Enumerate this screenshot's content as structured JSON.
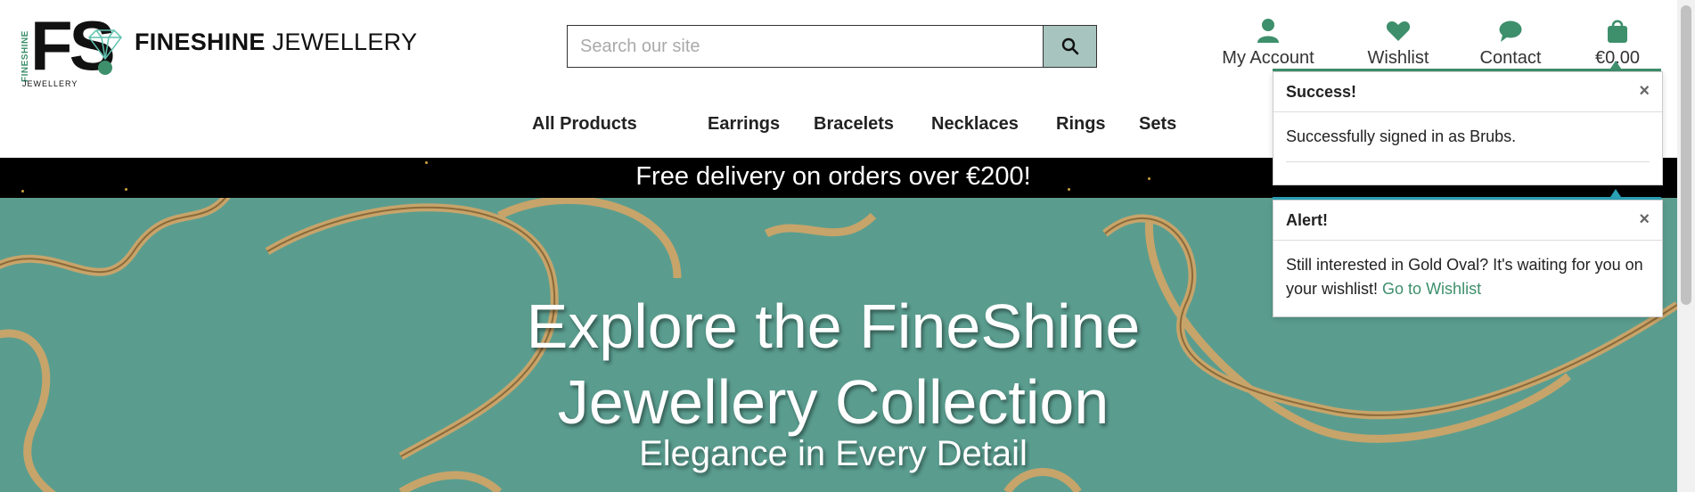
{
  "brand": {
    "bold": "FINESHINE",
    "light": " JEWELLERY",
    "logo_letters": "FS",
    "logo_side": "FINESHINE",
    "logo_bottom": "JEWELLERY"
  },
  "search": {
    "placeholder": "Search our site",
    "icon": "search-icon"
  },
  "nav_icons": [
    {
      "label": "My Account",
      "icon": "user-icon"
    },
    {
      "label": "Wishlist",
      "icon": "heart-icon"
    },
    {
      "label": "Contact",
      "icon": "chat-icon"
    },
    {
      "label": "€0.00",
      "icon": "shopping-bag-icon"
    }
  ],
  "menu": [
    "All Products",
    "Earrings",
    "Bracelets",
    "Necklaces",
    "Rings",
    "Sets"
  ],
  "banner": {
    "text": "Free delivery on orders over €200!"
  },
  "hero": {
    "title_line1": "Explore the FineShine",
    "title_line2": "Jewellery Collection",
    "subtitle": "Elegance in Every Detail"
  },
  "toasts": [
    {
      "title": "Success!",
      "message": "Successfully signed in as Brubs.",
      "close": "×"
    },
    {
      "title": "Alert!",
      "message": "Still interested in Gold Oval? It's waiting for you on your wishlist!",
      "link": "Go to Wishlist",
      "close": "×"
    }
  ],
  "colors": {
    "accent": "#3e8f6c",
    "hero_bg": "#5a9d8f",
    "search_btn": "#a8c4bf",
    "banner_bg": "#000000",
    "gold": "#c9a13a",
    "info_accent": "#2aa1b5"
  }
}
